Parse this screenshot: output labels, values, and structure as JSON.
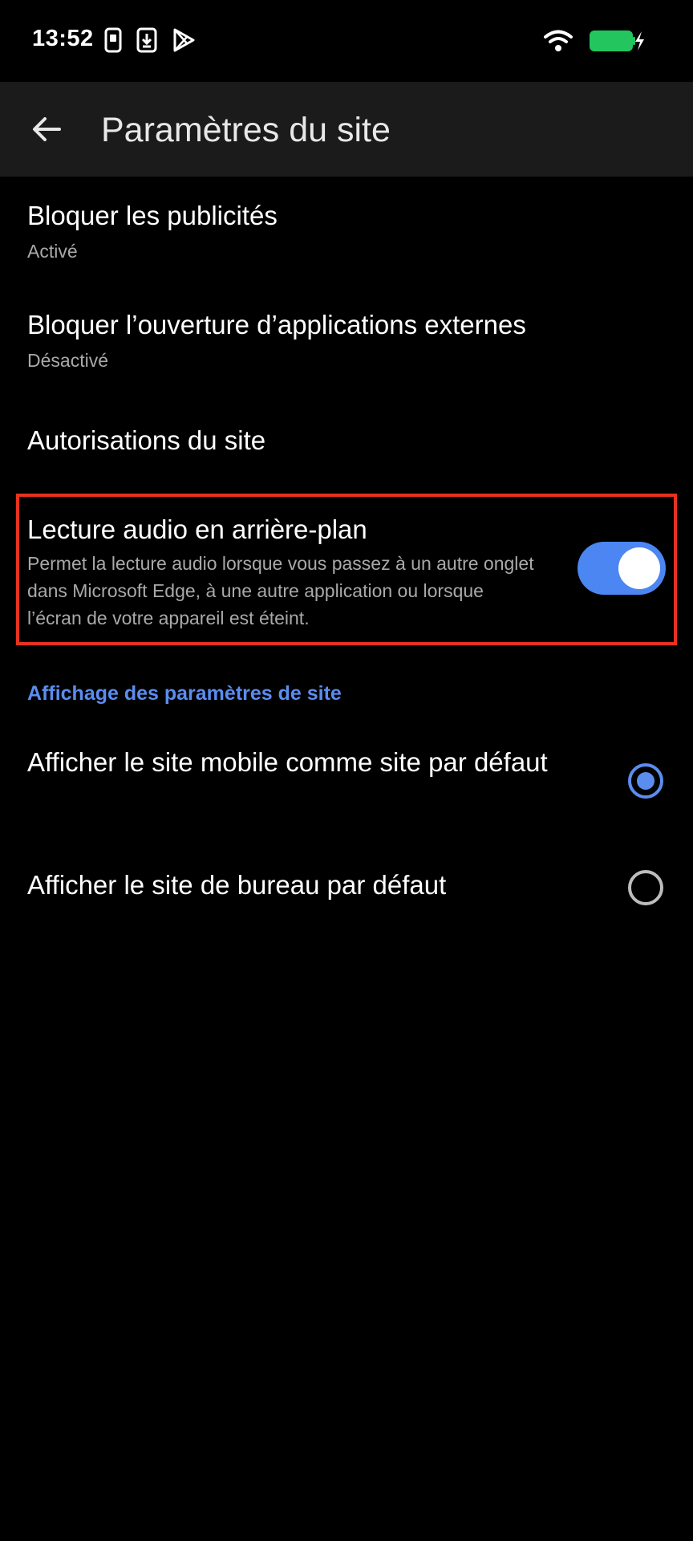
{
  "status_bar": {
    "time": "13:52",
    "left_icons": [
      "sim-card-icon",
      "download-icon",
      "play-store-icon"
    ],
    "right_icons": [
      "wifi-icon",
      "battery-charging-icon"
    ],
    "battery_color": "#22c55e"
  },
  "app_bar": {
    "title": "Paramètres du site",
    "back_icon": "arrow-left-icon"
  },
  "settings": {
    "block_ads": {
      "title": "Bloquer les publicités",
      "subtitle": "Activé"
    },
    "block_external_apps": {
      "title": "Bloquer l’ouverture d’applications externes",
      "subtitle": "Désactivé"
    },
    "site_permissions": {
      "title": "Autorisations du site"
    },
    "background_audio": {
      "title": "Lecture audio en arrière-plan",
      "description": "Permet la lecture audio lorsque vous passez à un autre onglet dans Microsoft Edge, à une autre application ou lorsque l’écran de votre appareil est éteint.",
      "enabled": true,
      "highlight_color": "#e8321e"
    }
  },
  "display_section": {
    "header": "Affichage des paramètres de site",
    "options": [
      {
        "label": "Afficher le site mobile comme site par défaut",
        "selected": true
      },
      {
        "label": "Afficher le site de bureau par défaut",
        "selected": false
      }
    ]
  },
  "colors": {
    "accent": "#5b8def",
    "toggle_on": "#4b86f2",
    "app_bar_bg": "#1b1b1b",
    "background": "#000000"
  }
}
